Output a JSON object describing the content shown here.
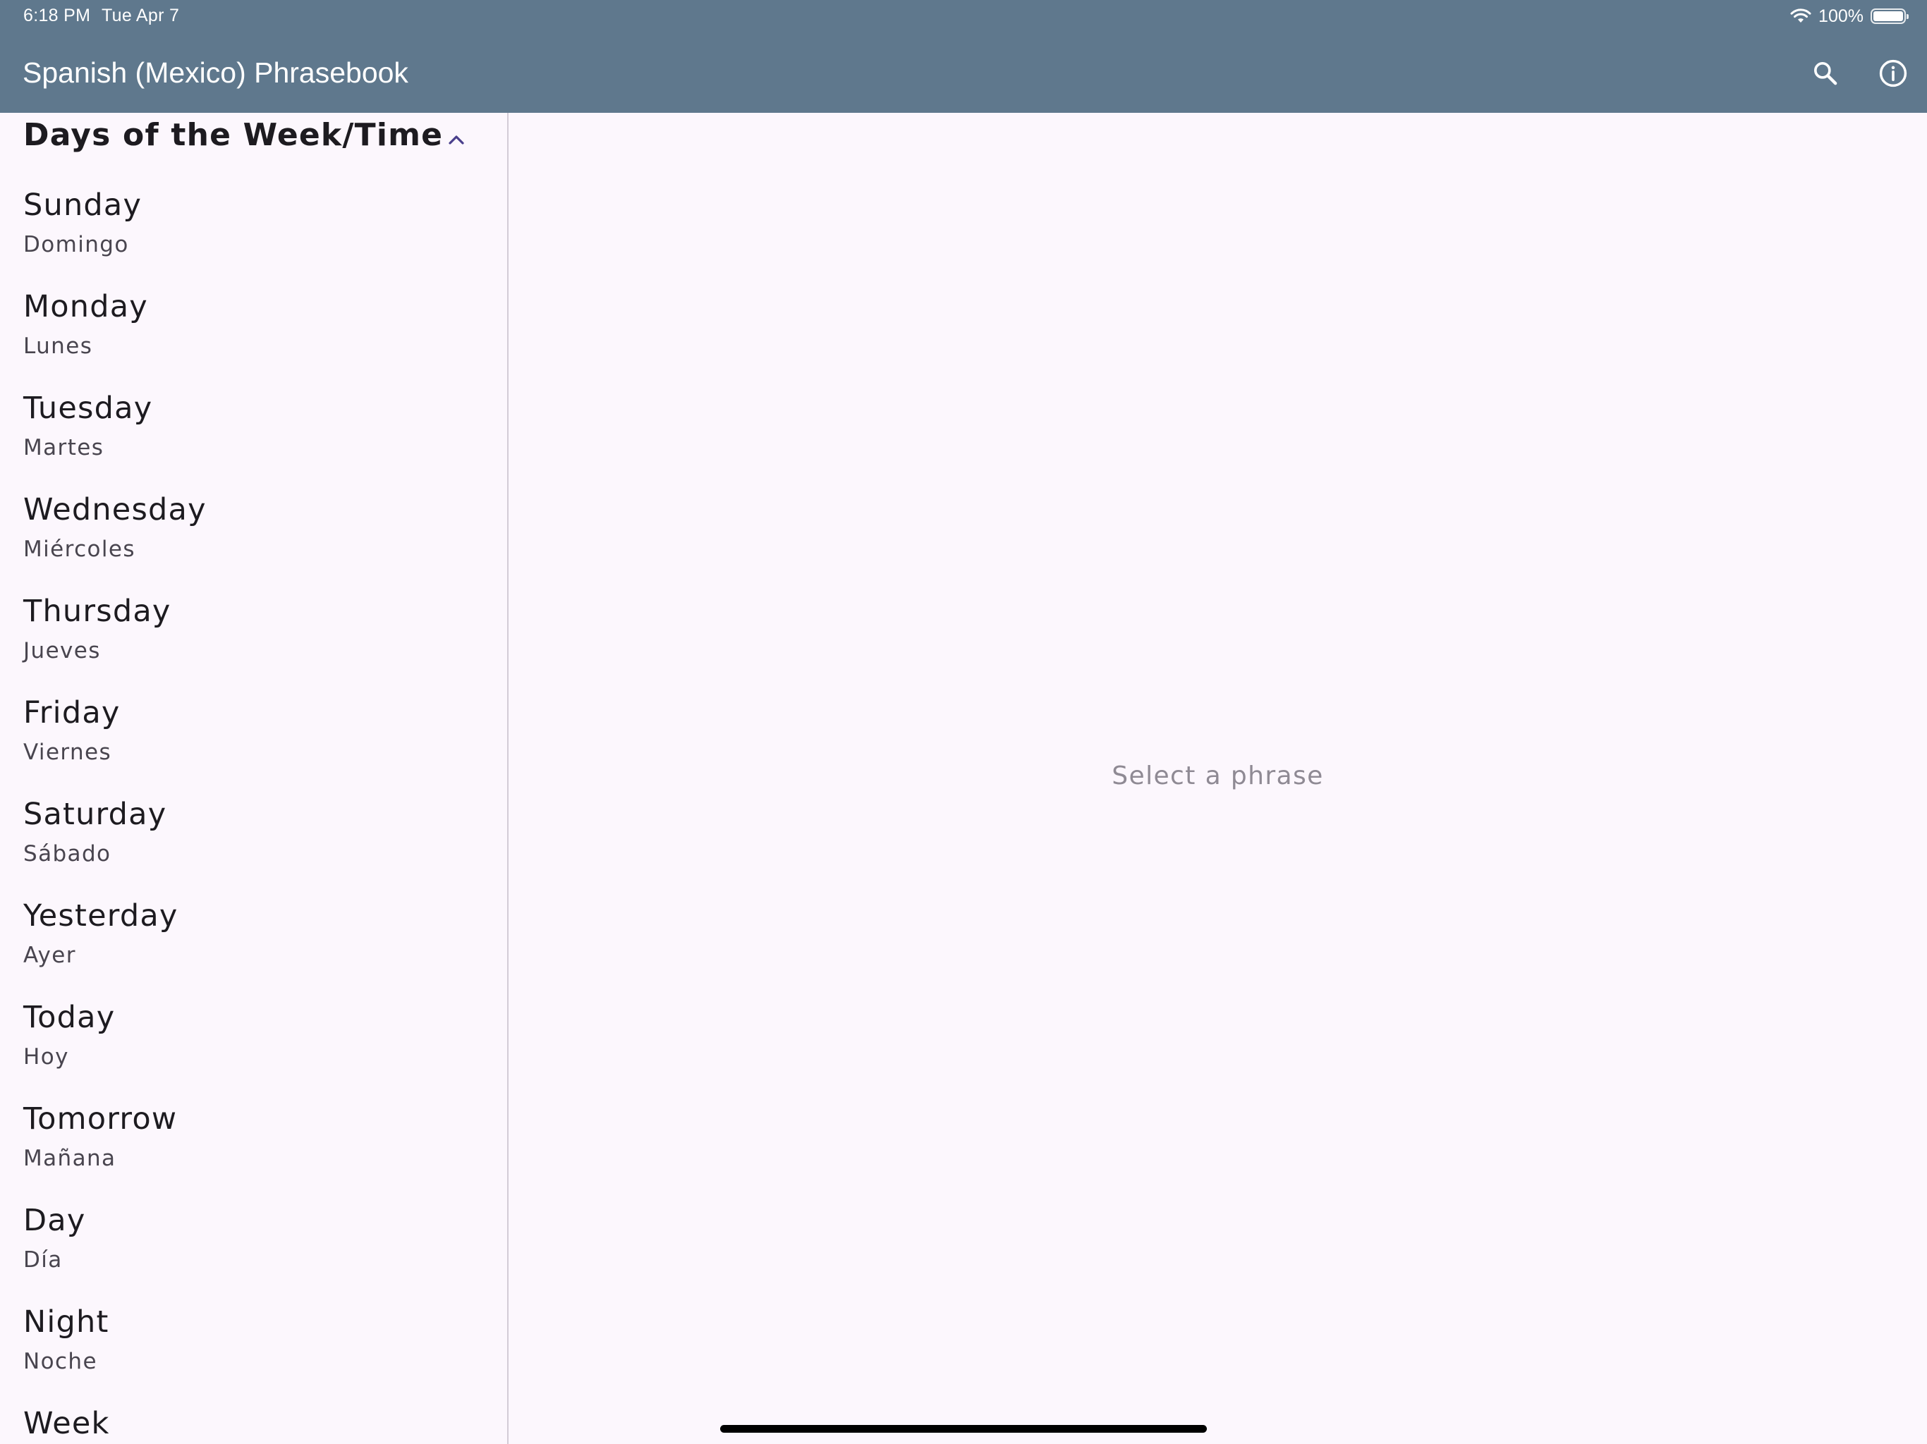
{
  "status_bar": {
    "time": "6:18 PM",
    "date": "Tue Apr 7",
    "battery_text": "100%",
    "battery_level": 1.0
  },
  "app_bar": {
    "title": "Spanish (Mexico) Phrasebook",
    "background_color": "#5F788D",
    "actions": [
      {
        "icon": "search-icon"
      },
      {
        "icon": "info-icon"
      }
    ]
  },
  "section": {
    "title": "Days of the Week/Time",
    "expanded": true,
    "icon": "chevron-up-icon",
    "accent_color": "#4A3F8C"
  },
  "phrases": [
    {
      "english": "Sunday",
      "spanish": "Domingo"
    },
    {
      "english": "Monday",
      "spanish": "Lunes"
    },
    {
      "english": "Tuesday",
      "spanish": "Martes"
    },
    {
      "english": "Wednesday",
      "spanish": "Miércoles"
    },
    {
      "english": "Thursday",
      "spanish": "Jueves"
    },
    {
      "english": "Friday",
      "spanish": "Viernes"
    },
    {
      "english": "Saturday",
      "spanish": "Sábado"
    },
    {
      "english": "Yesterday",
      "spanish": "Ayer"
    },
    {
      "english": "Today",
      "spanish": "Hoy"
    },
    {
      "english": "Tomorrow",
      "spanish": "Mañana"
    },
    {
      "english": "Day",
      "spanish": "Día"
    },
    {
      "english": "Night",
      "spanish": "Noche"
    },
    {
      "english": "Week",
      "spanish": ""
    }
  ],
  "detail": {
    "empty_text": "Select a phrase"
  }
}
